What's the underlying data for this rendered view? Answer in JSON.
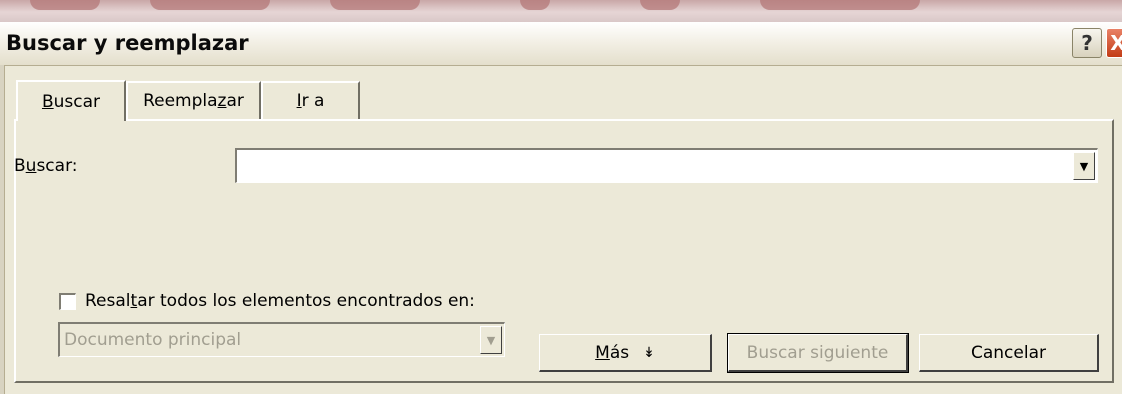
{
  "window": {
    "title": "Buscar y reemplazar",
    "help_label": "?",
    "close_label": "X"
  },
  "tabs": [
    {
      "pre": "",
      "key": "B",
      "post": "uscar"
    },
    {
      "pre": "Reempla",
      "key": "z",
      "post": "ar"
    },
    {
      "pre": "",
      "key": "I",
      "post": "r a"
    }
  ],
  "find": {
    "label_pre": "B",
    "label_key": "u",
    "label_post": "scar:",
    "value": ""
  },
  "highlight": {
    "label_pre": "Resal",
    "label_key": "t",
    "label_post": "ar todos los elementos encontrados en:",
    "checked": false,
    "scope_value": "Documento principal"
  },
  "buttons": {
    "more_key": "M",
    "more_post": "ás",
    "more_icon": "↡",
    "find_next": "Buscar siguiente",
    "cancel": "Cancelar"
  }
}
